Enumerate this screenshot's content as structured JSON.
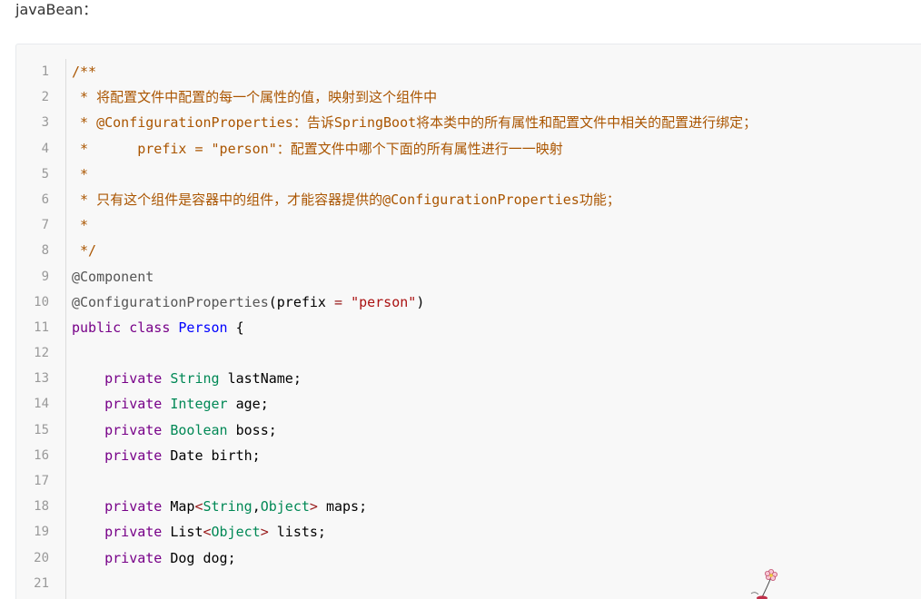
{
  "intro_text": "javaBean：",
  "code_lines": [
    {
      "num": "1",
      "tokens": [
        {
          "t": "/**",
          "c": "comment"
        }
      ]
    },
    {
      "num": "2",
      "tokens": [
        {
          "t": " * 将配置文件中配置的每一个属性的值，映射到这个组件中",
          "c": "comment"
        }
      ]
    },
    {
      "num": "3",
      "tokens": [
        {
          "t": " * @ConfigurationProperties：告诉SpringBoot将本类中的所有属性和配置文件中相关的配置进行绑定；",
          "c": "comment"
        }
      ]
    },
    {
      "num": "4",
      "tokens": [
        {
          "t": " *      prefix = \"person\"：配置文件中哪个下面的所有属性进行一一映射",
          "c": "comment"
        }
      ]
    },
    {
      "num": "5",
      "tokens": [
        {
          "t": " *",
          "c": "comment"
        }
      ]
    },
    {
      "num": "6",
      "tokens": [
        {
          "t": " * 只有这个组件是容器中的组件，才能容器提供的@ConfigurationProperties功能；",
          "c": "comment"
        }
      ]
    },
    {
      "num": "7",
      "tokens": [
        {
          "t": " *",
          "c": "comment"
        }
      ]
    },
    {
      "num": "8",
      "tokens": [
        {
          "t": " */",
          "c": "comment"
        }
      ]
    },
    {
      "num": "9",
      "tokens": [
        {
          "t": "@Component",
          "c": "anno"
        }
      ]
    },
    {
      "num": "10",
      "tokens": [
        {
          "t": "@ConfigurationProperties",
          "c": "anno"
        },
        {
          "t": "(",
          "c": "plain"
        },
        {
          "t": "prefix",
          "c": "plain"
        },
        {
          "t": " = ",
          "c": "op"
        },
        {
          "t": "\"person\"",
          "c": "string"
        },
        {
          "t": ")",
          "c": "plain"
        }
      ]
    },
    {
      "num": "11",
      "tokens": [
        {
          "t": "public",
          "c": "keyword"
        },
        {
          "t": " ",
          "c": "plain"
        },
        {
          "t": "class",
          "c": "keyword"
        },
        {
          "t": " ",
          "c": "plain"
        },
        {
          "t": "Person",
          "c": "def"
        },
        {
          "t": " {",
          "c": "plain"
        }
      ]
    },
    {
      "num": "12",
      "tokens": []
    },
    {
      "num": "13",
      "tokens": [
        {
          "t": "    ",
          "c": "plain"
        },
        {
          "t": "private",
          "c": "keyword"
        },
        {
          "t": " ",
          "c": "plain"
        },
        {
          "t": "String",
          "c": "type"
        },
        {
          "t": " lastName;",
          "c": "plain"
        }
      ]
    },
    {
      "num": "14",
      "tokens": [
        {
          "t": "    ",
          "c": "plain"
        },
        {
          "t": "private",
          "c": "keyword"
        },
        {
          "t": " ",
          "c": "plain"
        },
        {
          "t": "Integer",
          "c": "type"
        },
        {
          "t": " age;",
          "c": "plain"
        }
      ]
    },
    {
      "num": "15",
      "tokens": [
        {
          "t": "    ",
          "c": "plain"
        },
        {
          "t": "private",
          "c": "keyword"
        },
        {
          "t": " ",
          "c": "plain"
        },
        {
          "t": "Boolean",
          "c": "type"
        },
        {
          "t": " boss;",
          "c": "plain"
        }
      ]
    },
    {
      "num": "16",
      "tokens": [
        {
          "t": "    ",
          "c": "plain"
        },
        {
          "t": "private",
          "c": "keyword"
        },
        {
          "t": " Date birth;",
          "c": "plain"
        }
      ]
    },
    {
      "num": "17",
      "tokens": []
    },
    {
      "num": "18",
      "tokens": [
        {
          "t": "    ",
          "c": "plain"
        },
        {
          "t": "private",
          "c": "keyword"
        },
        {
          "t": " Map",
          "c": "plain"
        },
        {
          "t": "<",
          "c": "op"
        },
        {
          "t": "String",
          "c": "type"
        },
        {
          "t": ",",
          "c": "plain"
        },
        {
          "t": "Object",
          "c": "type"
        },
        {
          "t": ">",
          "c": "op"
        },
        {
          "t": " maps;",
          "c": "plain"
        }
      ]
    },
    {
      "num": "19",
      "tokens": [
        {
          "t": "    ",
          "c": "plain"
        },
        {
          "t": "private",
          "c": "keyword"
        },
        {
          "t": " List",
          "c": "plain"
        },
        {
          "t": "<",
          "c": "op"
        },
        {
          "t": "Object",
          "c": "type"
        },
        {
          "t": ">",
          "c": "op"
        },
        {
          "t": " lists;",
          "c": "plain"
        }
      ]
    },
    {
      "num": "20",
      "tokens": [
        {
          "t": "    ",
          "c": "plain"
        },
        {
          "t": "private",
          "c": "keyword"
        },
        {
          "t": " Dog dog;",
          "c": "plain"
        }
      ]
    },
    {
      "num": "21",
      "tokens": []
    }
  ],
  "colors": {
    "comment": "#aa5500",
    "keyword": "#770088",
    "type": "#008855",
    "string": "#aa1111",
    "def": "#0000ff"
  },
  "icons": {
    "flower": "flower-icon"
  }
}
